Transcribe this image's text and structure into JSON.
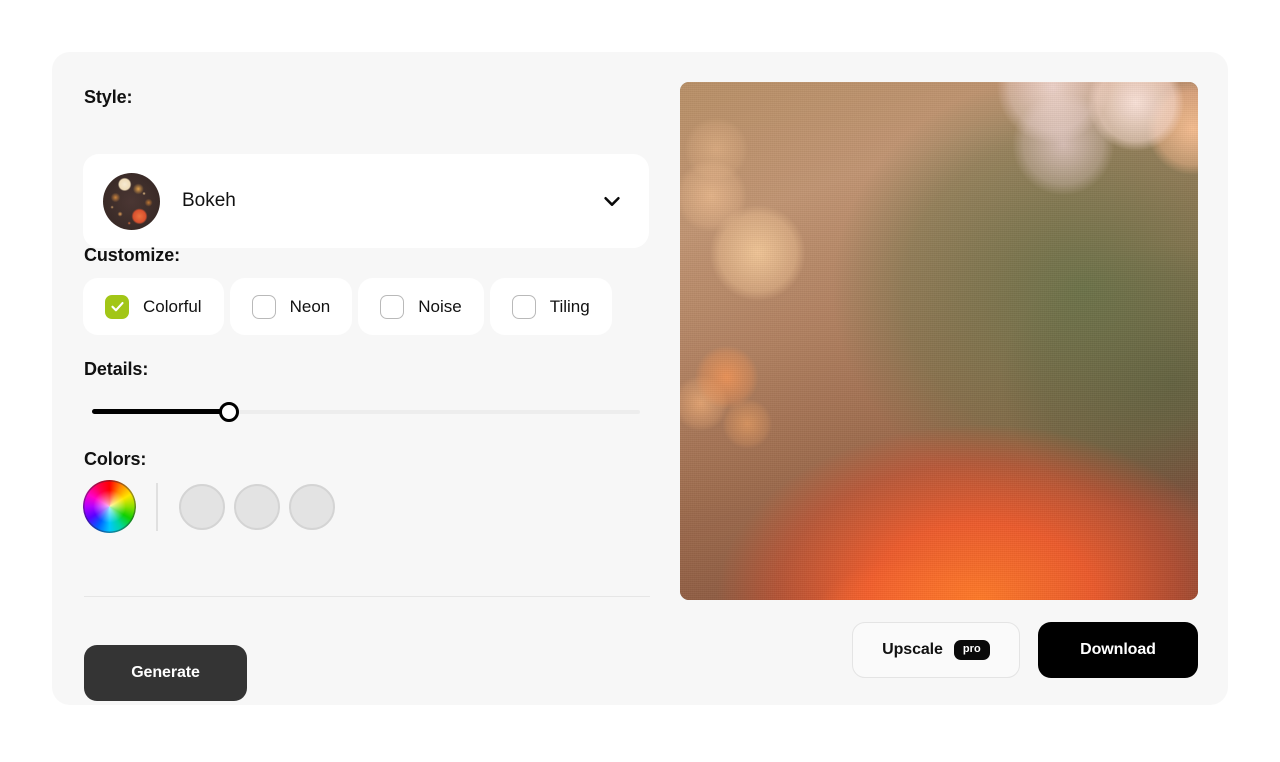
{
  "style": {
    "label": "Style:",
    "selected": "Bokeh",
    "thumbnail_name": "bokeh-style-thumbnail",
    "chevron_icon": "chevron-down-icon"
  },
  "customize": {
    "label": "Customize:",
    "options": [
      {
        "label": "Colorful",
        "checked": true
      },
      {
        "label": "Neon",
        "checked": false
      },
      {
        "label": "Noise",
        "checked": false
      },
      {
        "label": "Tiling",
        "checked": false
      }
    ],
    "checked_color": "#a2c617"
  },
  "details": {
    "label": "Details:",
    "value_percent": 25,
    "min": 0,
    "max": 100
  },
  "colors": {
    "label": "Colors:",
    "wheel_name": "color-wheel-picker",
    "swatches": [
      {
        "name": "color-swatch-1",
        "filled": false
      },
      {
        "name": "color-swatch-2",
        "filled": false
      },
      {
        "name": "color-swatch-3",
        "filled": false
      }
    ],
    "empty_swatch_color": "#e3e3e3"
  },
  "actions": {
    "generate_label": "Generate",
    "upscale_label": "Upscale",
    "upscale_badge": "pro",
    "download_label": "Download"
  },
  "preview": {
    "name": "generated-bokeh-image",
    "alt": "Generated bokeh wallpaper preview"
  },
  "theme": {
    "page_background": "#ffffff",
    "card_background": "#f7f7f7",
    "generate_button": "#343434",
    "download_button": "#000000",
    "accent": "#a2c617"
  }
}
